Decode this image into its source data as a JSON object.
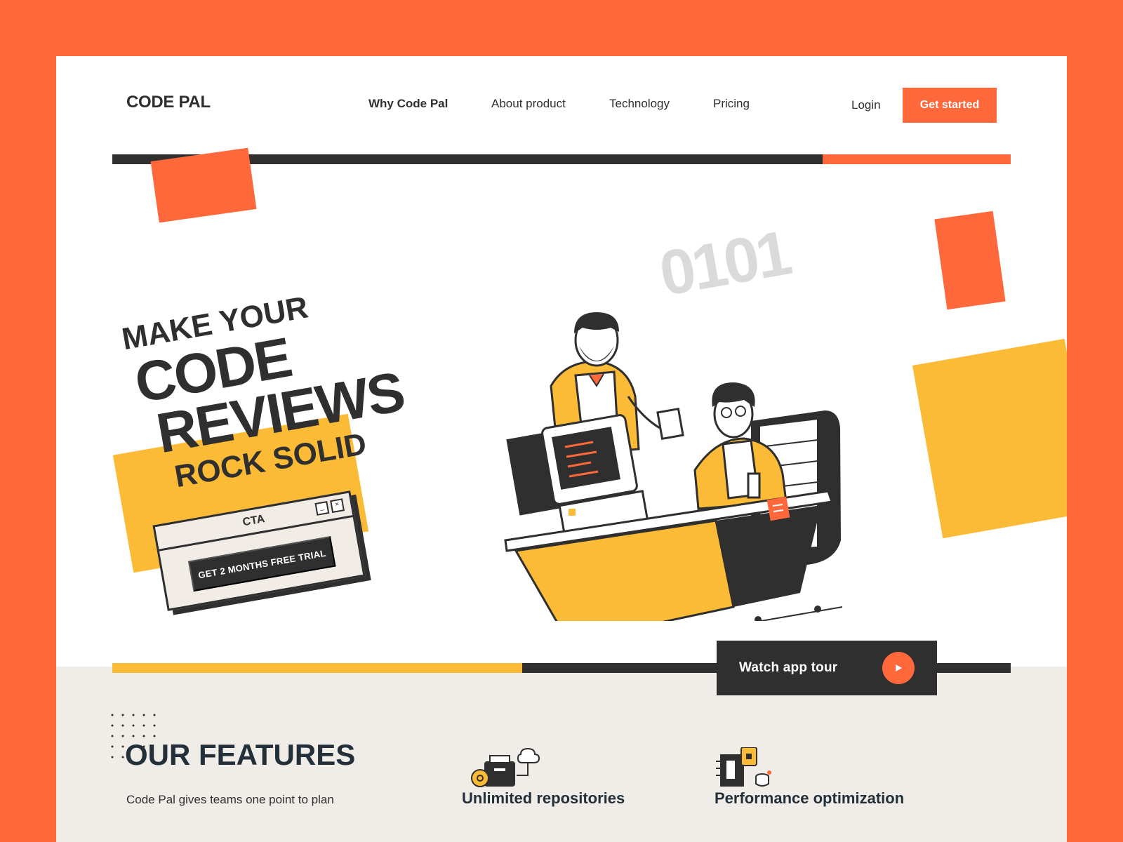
{
  "colors": {
    "accent": "#FF683A",
    "yellow": "#FBBB37",
    "dark": "#2F2F2F",
    "beige": "#F0ECE7"
  },
  "header": {
    "logo": "CODE PAL",
    "nav": [
      "Why Code Pal",
      "About product",
      "Technology",
      "Pricing"
    ],
    "login": "Login",
    "cta": "Get started"
  },
  "hero": {
    "line1": "MAKE YOUR",
    "line2": "CODE",
    "line3": "REVIEWS",
    "line4": "ROCK SOLID",
    "binary": "0101",
    "cta_window": {
      "title": "CTA",
      "button": "GET 2 MONTHS FREE TRIAL"
    }
  },
  "tour": {
    "label": "Watch app tour"
  },
  "features": {
    "title": "OUR FEATURES",
    "description": "Code Pal gives teams one point to plan",
    "items": [
      {
        "label": "Unlimited  repositories",
        "icon": "repository-icon"
      },
      {
        "label": "Performance optimization",
        "icon": "performance-icon"
      }
    ]
  }
}
